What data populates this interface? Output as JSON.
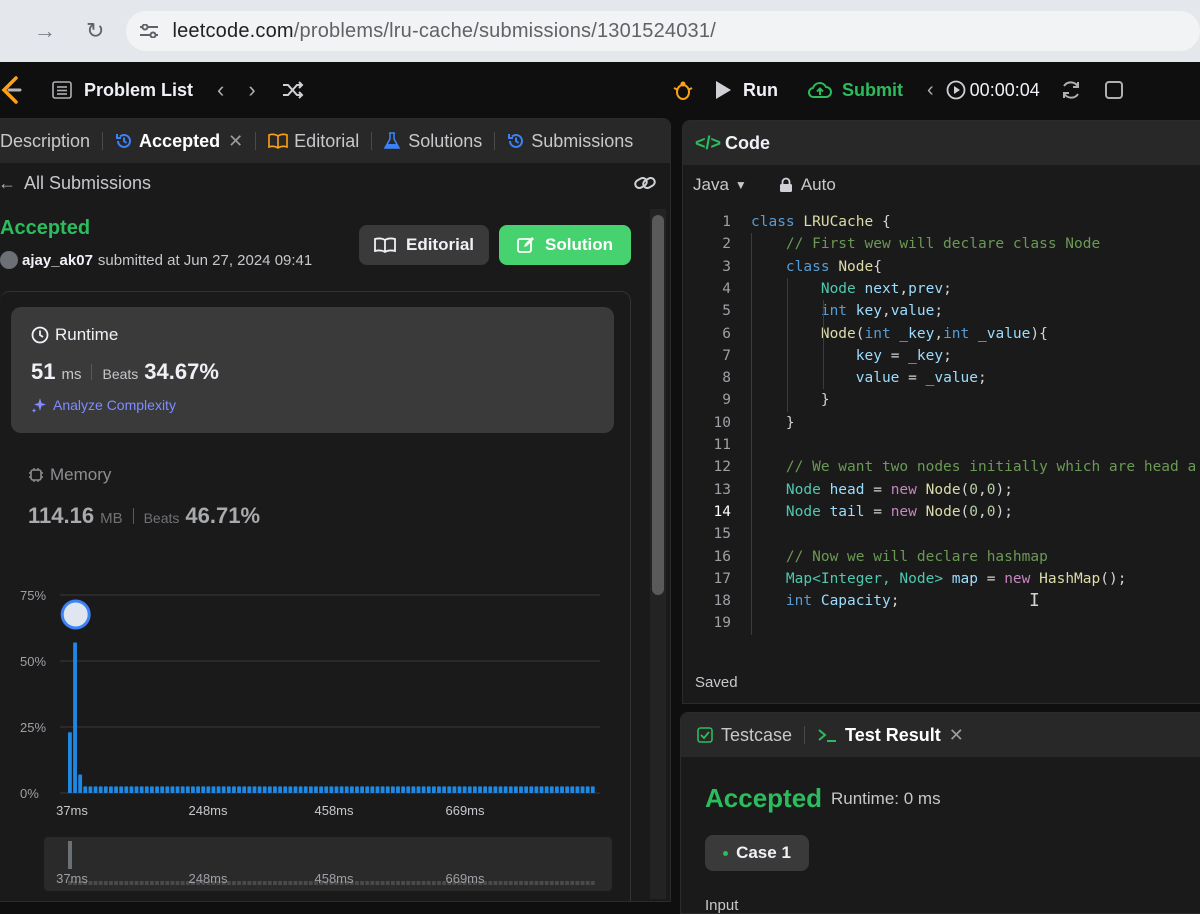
{
  "browser": {
    "url_host": "leetcode.com",
    "url_path": "/problems/lru-cache/submissions/1301524031/"
  },
  "nav": {
    "problem_list": "Problem List",
    "run": "Run",
    "submit": "Submit",
    "timer": "00:00:04"
  },
  "left_tabs": [
    {
      "label": "Description"
    },
    {
      "label": "Accepted"
    },
    {
      "label": "Editorial"
    },
    {
      "label": "Solutions"
    },
    {
      "label": "Submissions"
    }
  ],
  "submission": {
    "back_label": "All Submissions",
    "status": "Accepted",
    "user": "ajay_ak07",
    "submitted_at": "submitted at Jun 27, 2024 09:41",
    "editorial_button": "Editorial",
    "solution_button": "Solution"
  },
  "runtime": {
    "title": "Runtime",
    "value": "51",
    "unit": "ms",
    "beats_label": "Beats",
    "beats_pct": "34.67%",
    "analyze": "Analyze Complexity"
  },
  "memory": {
    "title": "Memory",
    "value": "114.16",
    "unit": "MB",
    "beats_label": "Beats",
    "beats_pct": "46.71%"
  },
  "chart_data": {
    "type": "bar",
    "y_ticks": [
      "75%",
      "50%",
      "25%",
      "0%"
    ],
    "ylim": [
      0,
      75
    ],
    "x_ticks": [
      "37ms",
      "248ms",
      "458ms",
      "669ms"
    ],
    "values": [
      23,
      57,
      7,
      2.5,
      2.5,
      2.5,
      2.5,
      2.5,
      2.5,
      2.5,
      2.5,
      2.5,
      2.5,
      2.5,
      2.5,
      2.5,
      2.5,
      2.5,
      2.5,
      2.5,
      2.5,
      2.5,
      2.5,
      2.5,
      2.5,
      2.5,
      2.5,
      2.5,
      2.5,
      2.5,
      2.5,
      2.5,
      2.5,
      2.5,
      2.5,
      2.5,
      2.5,
      2.5,
      2.5,
      2.5,
      2.5,
      2.5,
      2.5,
      2.5,
      2.5,
      2.5,
      2.5,
      2.5,
      2.5,
      2.5,
      2.5,
      2.5,
      2.5,
      2.5,
      2.5,
      2.5,
      2.5,
      2.5,
      2.5,
      2.5,
      2.5,
      2.5,
      2.5,
      2.5,
      2.5,
      2.5,
      2.5,
      2.5,
      2.5,
      2.5,
      2.5,
      2.5,
      2.5,
      2.5,
      2.5,
      2.5,
      2.5,
      2.5,
      2.5,
      2.5,
      2.5,
      2.5,
      2.5,
      2.5,
      2.5,
      2.5,
      2.5,
      2.5,
      2.5,
      2.5,
      2.5,
      2.5,
      2.5,
      2.5,
      2.5,
      2.5,
      2.5,
      2.5,
      2.5,
      2.5,
      2.5,
      2.5,
      2.5
    ],
    "user_bar_index": 1,
    "bar_color": "#1e88e5",
    "grid": true
  },
  "colors": {
    "accent_green": "#2cbb5d",
    "solution_green": "#47d270",
    "link_purple": "#7f8cff"
  },
  "code_panel": {
    "title": "Code",
    "language": "Java",
    "mode": "Auto",
    "saved": "Saved",
    "current_line": 14,
    "lines": [
      [
        [
          "kw",
          "class "
        ],
        [
          "cls",
          "LRUCache"
        ],
        [
          "pl",
          " {"
        ]
      ],
      [
        [
          "pl",
          "    "
        ],
        [
          "cm",
          "// First wew will declare class Node"
        ]
      ],
      [
        [
          "pl",
          "    "
        ],
        [
          "kw",
          "class "
        ],
        [
          "cls",
          "Node"
        ],
        [
          "pl",
          "{"
        ]
      ],
      [
        [
          "pl",
          "        "
        ],
        [
          "kw",
          "Node "
        ],
        [
          "id",
          "next"
        ],
        [
          "pl",
          ","
        ],
        [
          "id",
          "prev"
        ],
        [
          "pl",
          ";"
        ]
      ],
      [
        [
          "pl",
          "        "
        ],
        [
          "kw",
          "int "
        ],
        [
          "id",
          "key"
        ],
        [
          "pl",
          ","
        ],
        [
          "id",
          "value"
        ],
        [
          "pl",
          ";"
        ]
      ],
      [
        [
          "pl",
          "        "
        ],
        [
          "fn",
          "Node"
        ],
        [
          "pl",
          "("
        ],
        [
          "kw",
          "int "
        ],
        [
          "id",
          "_key"
        ],
        [
          "pl",
          ","
        ],
        [
          "kw",
          "int "
        ],
        [
          "id",
          "_value"
        ],
        [
          "pl",
          "){"
        ]
      ],
      [
        [
          "pl",
          "            "
        ],
        [
          "id",
          "key"
        ],
        [
          "pl",
          " = "
        ],
        [
          "id",
          "_key"
        ],
        [
          "pl",
          ";"
        ]
      ],
      [
        [
          "pl",
          "            "
        ],
        [
          "id",
          "value"
        ],
        [
          "pl",
          " = "
        ],
        [
          "id",
          "_value"
        ],
        [
          "pl",
          ";"
        ]
      ],
      [
        [
          "pl",
          "        }"
        ]
      ],
      [
        [
          "pl",
          "    }"
        ]
      ],
      [
        [
          "pl",
          ""
        ]
      ],
      [
        [
          "pl",
          "    "
        ],
        [
          "cm",
          "// We want two nodes initially which are head a"
        ]
      ],
      [
        [
          "pl",
          "    "
        ],
        [
          "kw",
          "Node "
        ],
        [
          "id",
          "head"
        ],
        [
          "pl",
          " = "
        ],
        [
          "nw",
          "new "
        ],
        [
          "fn",
          "Node"
        ],
        [
          "pl",
          "("
        ],
        [
          "num",
          "0"
        ],
        [
          "pl",
          ","
        ],
        [
          "num",
          "0"
        ],
        [
          "pl",
          ");"
        ]
      ],
      [
        [
          "pl",
          "    "
        ],
        [
          "kw",
          "Node "
        ],
        [
          "id",
          "tail"
        ],
        [
          "pl",
          " = "
        ],
        [
          "nw",
          "new "
        ],
        [
          "fn",
          "Node"
        ],
        [
          "pl",
          "("
        ],
        [
          "num",
          "0"
        ],
        [
          "pl",
          ","
        ],
        [
          "num",
          "0"
        ],
        [
          "pl",
          ");"
        ]
      ],
      [
        [
          "pl",
          ""
        ]
      ],
      [
        [
          "pl",
          "    "
        ],
        [
          "cm",
          "// Now we will declare hashmap"
        ]
      ],
      [
        [
          "pl",
          "    "
        ],
        [
          "kw",
          "Map<Integer, Node> "
        ],
        [
          "id",
          "map"
        ],
        [
          "pl",
          " = "
        ],
        [
          "nw",
          "new "
        ],
        [
          "fn",
          "HashMap"
        ],
        [
          "pl",
          "();"
        ]
      ],
      [
        [
          "pl",
          "    "
        ],
        [
          "kw",
          "int "
        ],
        [
          "id",
          "Capacity"
        ],
        [
          "pl",
          ";"
        ]
      ],
      [
        [
          "pl",
          ""
        ]
      ]
    ]
  },
  "test_panel": {
    "tab_testcase": "Testcase",
    "tab_result": "Test Result",
    "status": "Accepted",
    "runtime": "Runtime: 0 ms",
    "case": "Case 1",
    "input_label": "Input"
  }
}
